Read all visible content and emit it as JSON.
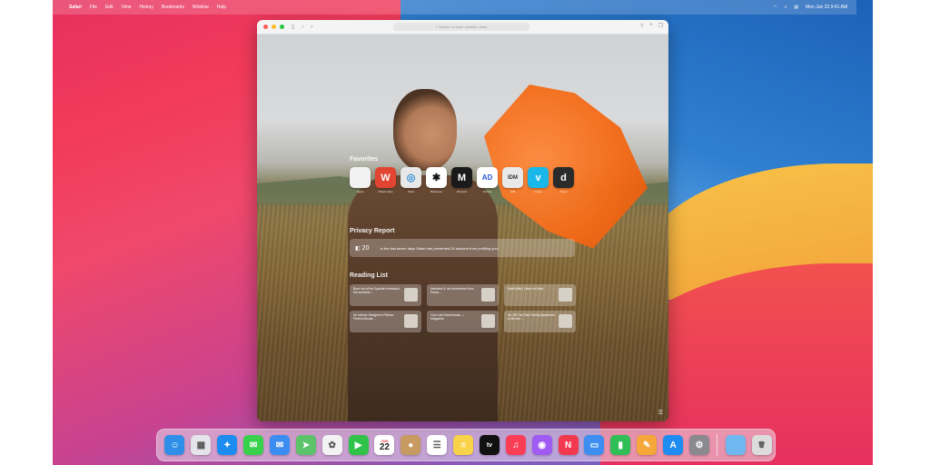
{
  "menubar": {
    "apple": "",
    "items": [
      "Safari",
      "File",
      "Edit",
      "View",
      "History",
      "Bookmarks",
      "Window",
      "Help"
    ],
    "clock": "Mon Jun 22  9:41 AM"
  },
  "browser": {
    "address_placeholder": "Search or enter website name"
  },
  "start_page": {
    "favorites_title": "Favorites",
    "favorites": [
      {
        "label": "Apple",
        "glyph": "",
        "color": "#f2f2f2",
        "text": "#222"
      },
      {
        "label": "Alfred Adam",
        "glyph": "W",
        "color": "#e24432",
        "text": "#fff"
      },
      {
        "label": "Wind",
        "glyph": "◎",
        "color": "#e8e8e8",
        "text": "#2d8fd5"
      },
      {
        "label": "Bobapear",
        "glyph": "✱",
        "color": "#ffffff",
        "text": "#111"
      },
      {
        "label": "Monocle",
        "glyph": "M",
        "color": "#1a1a1a",
        "text": "#fff"
      },
      {
        "label": "Ad Hoc",
        "glyph": "AD",
        "color": "#ffffff",
        "text": "#2a5bd7"
      },
      {
        "label": "IDM",
        "glyph": "IDM",
        "color": "#e9e9e9",
        "text": "#333"
      },
      {
        "label": "Vimeo",
        "glyph": "v",
        "color": "#19b7ea",
        "text": "#fff"
      },
      {
        "label": "Dwell",
        "glyph": "d",
        "color": "#2b2b2b",
        "text": "#fff"
      }
    ],
    "privacy_title": "Privacy Report",
    "privacy_count": "20",
    "privacy_text": "In the last seven days Safari has prevented 20 trackers from profiling you.",
    "reading_title": "Reading List",
    "reading_items": [
      {
        "title": "Born out of the Spanish recession, the architect…"
      },
      {
        "title": "Interview & mo revivement from Paula…"
      },
      {
        "title": "MacGuffin | Desk on Deck"
      },
      {
        "title": "An Interior Designer's Picture-Perfect Brookl…"
      },
      {
        "title": "Your Lab Greenhouse — Magazine"
      },
      {
        "title": "An Off-The-Plan Family Apartment to Be Ars…"
      }
    ]
  },
  "dock": {
    "calendar_month": "JUN",
    "calendar_day": "22",
    "apps": [
      {
        "name": "finder-icon",
        "glyph": "☺",
        "color": "#2f8fe8"
      },
      {
        "name": "launchpad-icon",
        "glyph": "▦",
        "color": "#e4e4ea"
      },
      {
        "name": "safari-icon",
        "glyph": "✦",
        "color": "#1d8cf0"
      },
      {
        "name": "messages-icon",
        "glyph": "✉",
        "color": "#38d14c"
      },
      {
        "name": "mail-icon",
        "glyph": "✉",
        "color": "#3c8df1"
      },
      {
        "name": "maps-icon",
        "glyph": "➤",
        "color": "#5cc36b"
      },
      {
        "name": "photos-icon",
        "glyph": "✿",
        "color": "#f3f3f3"
      },
      {
        "name": "facetime-icon",
        "glyph": "▶",
        "color": "#2fc449"
      },
      {
        "name": "calendar-icon",
        "glyph": "22",
        "color": "#ffffff"
      },
      {
        "name": "contacts-icon",
        "glyph": "●",
        "color": "#c79a61"
      },
      {
        "name": "reminders-icon",
        "glyph": "☰",
        "color": "#ffffff"
      },
      {
        "name": "notes-icon",
        "glyph": "≡",
        "color": "#f8d34a"
      },
      {
        "name": "tv-icon",
        "glyph": "tv",
        "color": "#111111"
      },
      {
        "name": "music-icon",
        "glyph": "♫",
        "color": "#fb3e56"
      },
      {
        "name": "podcasts-icon",
        "glyph": "◉",
        "color": "#a05cf2"
      },
      {
        "name": "news-icon",
        "glyph": "N",
        "color": "#f3394f"
      },
      {
        "name": "keynote-icon",
        "glyph": "▭",
        "color": "#3e8df0"
      },
      {
        "name": "numbers-icon",
        "glyph": "▮",
        "color": "#2fbf56"
      },
      {
        "name": "pages-icon",
        "glyph": "✎",
        "color": "#f6a73a"
      },
      {
        "name": "app-store-icon",
        "glyph": "A",
        "color": "#1e8cf0"
      },
      {
        "name": "system-preferences-icon",
        "glyph": "⚙",
        "color": "#8a8a8e"
      }
    ],
    "trailing": [
      {
        "name": "downloads-folder-icon",
        "glyph": "",
        "color": "#6fb8ef"
      },
      {
        "name": "trash-icon",
        "glyph": "🗑",
        "color": "#dcdcdc"
      }
    ]
  }
}
